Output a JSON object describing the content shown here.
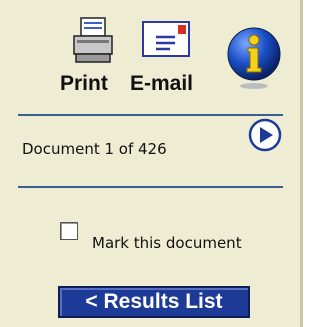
{
  "toolbar": {
    "print_label": "Print",
    "email_label": "E-mail",
    "print_icon": "printer-icon",
    "email_icon": "envelope-icon",
    "info_icon": "info-icon"
  },
  "navigation": {
    "document_status": "Document 1 of 426",
    "next_icon": "next-arrow-icon"
  },
  "mark": {
    "label": "Mark this document",
    "checked": false
  },
  "results_button": {
    "label": "< Results List"
  },
  "colors": {
    "panel_bg": "#eeecd2",
    "divider": "#3a5f8e",
    "button_bg": "#1c3a96"
  }
}
